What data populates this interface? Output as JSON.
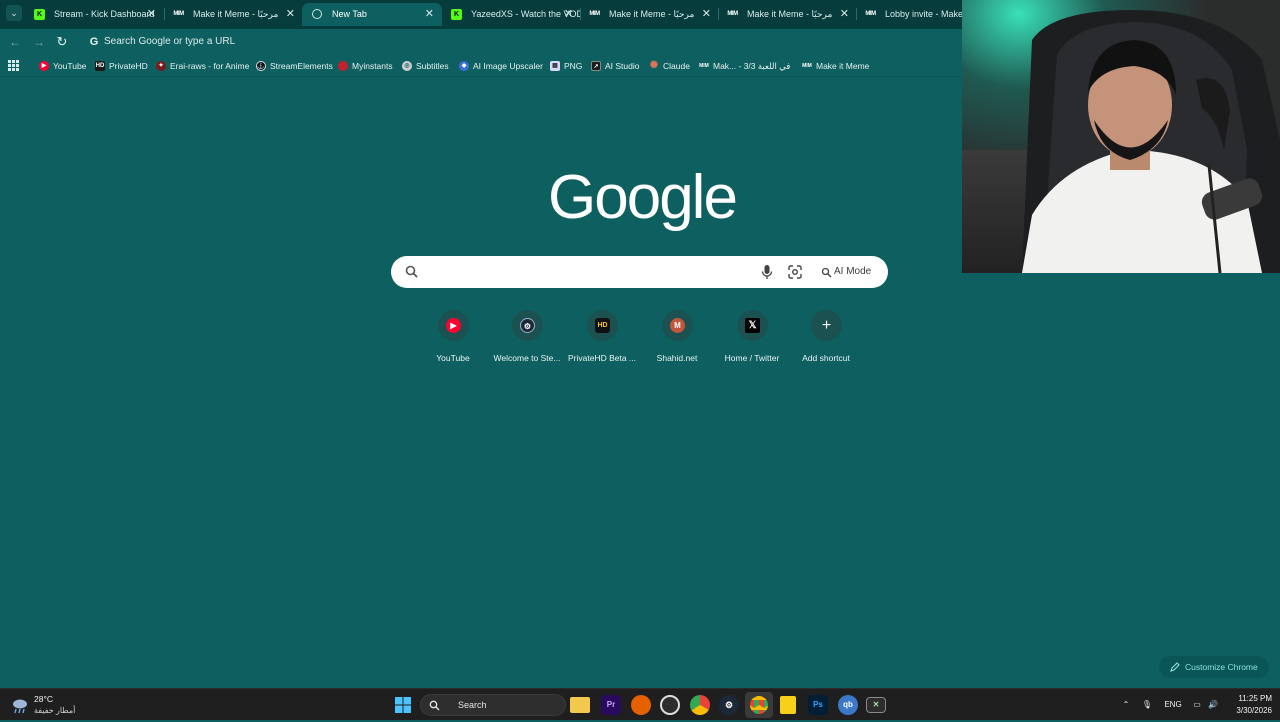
{
  "tabs": [
    {
      "title": "Stream - Kick Dashboard",
      "favicon": "kick-icon",
      "active": false
    },
    {
      "title": "Make it Meme - مرحبًا",
      "favicon": "makeitmeme-icon",
      "active": false
    },
    {
      "title": "New Tab",
      "favicon": "globe-icon",
      "active": true
    },
    {
      "title": "YazeedXS - Watch the VOD",
      "favicon": "kick-icon",
      "active": false
    },
    {
      "title": "Make it Meme - مرحبًا",
      "favicon": "makeitmeme-icon",
      "active": false
    },
    {
      "title": "Make it Meme - مرحبًا",
      "favicon": "makeitmeme-icon",
      "active": false
    },
    {
      "title": "Lobby invite - Make it Meme",
      "favicon": "makeitmeme-icon",
      "active": false
    }
  ],
  "toolbar": {
    "omnibox_placeholder": "Search Google or type a URL"
  },
  "bookmarks": [
    {
      "label": "YouTube",
      "icon": "youtube-icon",
      "color": "#ff0033"
    },
    {
      "label": "PrivateHD",
      "icon": "privatehd-icon",
      "color": "#1a1a1a"
    },
    {
      "label": "Erai-raws - for Anime",
      "icon": "erai-icon",
      "color": "#7a1b1b"
    },
    {
      "label": "StreamElements",
      "icon": "streamelements-icon",
      "color": "#111111"
    },
    {
      "label": "Myinstants",
      "icon": "myinstants-icon",
      "color": "#c21f2f"
    },
    {
      "label": "Subtitles",
      "icon": "subtitles-icon",
      "color": "#cfcfcf"
    },
    {
      "label": "AI Image Upscaler",
      "icon": "upscaler-icon",
      "color": "#3a6fd8"
    },
    {
      "label": "PNG",
      "icon": "png-icon",
      "color": "#d8d8ff"
    },
    {
      "label": "AI Studio",
      "icon": "aistudio-icon",
      "color": "#1b1b1b"
    },
    {
      "label": "Claude",
      "icon": "claude-icon",
      "color": "#d97757"
    },
    {
      "label": "Mak... - 3/3 في اللعبة",
      "icon": "makeitmeme-icon",
      "color": "#ffffff"
    },
    {
      "label": "Make it Meme",
      "icon": "makeitmeme-icon",
      "color": "#ffffff"
    }
  ],
  "ntp": {
    "logo_text": "Google",
    "search_placeholder": "",
    "ai_mode_label": "AI Mode",
    "shortcuts": [
      {
        "label": "YouTube",
        "icon": "youtube-icon",
        "color": "#ff0033"
      },
      {
        "label": "Welcome to Ste...",
        "icon": "steam-icon",
        "color": "#1b2838"
      },
      {
        "label": "PrivateHD Beta ...",
        "icon": "privatehd-icon",
        "color": "#111111"
      },
      {
        "label": "Shahid.net",
        "icon": "shahid-icon",
        "color": "#c0563a"
      },
      {
        "label": "Home / Twitter",
        "icon": "x-icon",
        "color": "#000000"
      },
      {
        "label": "Add shortcut",
        "icon": "plus-icon",
        "color": "#1b5151"
      }
    ],
    "customize_label": "Customize Chrome"
  },
  "taskbar": {
    "weather_temp": "28°C",
    "weather_condition": "أمطار خفيفة",
    "search_label": "Search",
    "apps": [
      {
        "name": "file-explorer-icon",
        "color": "#f2c94c"
      },
      {
        "name": "premiere-icon",
        "color": "#2a0a5e"
      },
      {
        "name": "firefox-icon",
        "color": "#e66000"
      },
      {
        "name": "obs-icon",
        "color": "#3a3a3a"
      },
      {
        "name": "chrome-icon",
        "color": "#34a853"
      },
      {
        "name": "steam-icon",
        "color": "#1b2838"
      },
      {
        "name": "chrome-active-icon",
        "color": "#4285f4"
      },
      {
        "name": "sticky-notes-icon",
        "color": "#f7d117"
      },
      {
        "name": "photoshop-icon",
        "color": "#001e36"
      },
      {
        "name": "qbittorrent-icon",
        "color": "#3c78c8"
      },
      {
        "name": "terminal-icon",
        "color": "#2d2d2d"
      }
    ],
    "language": "ENG",
    "time": "11:25 PM",
    "date": "3/30/2026"
  }
}
